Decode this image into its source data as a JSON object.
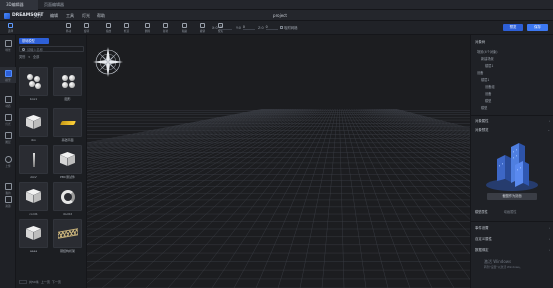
{
  "tabs": [
    "3D编辑器",
    "页面编辑器"
  ],
  "menu": {
    "logo": "DREAMSOFT",
    "items": [
      "文件",
      "编辑",
      "工具",
      "灯光",
      "帮助"
    ],
    "doc_title": "project"
  },
  "toolbar": {
    "tools": [
      "选择",
      "移动",
      "旋转",
      "缩放",
      "框选",
      "删除",
      "复制",
      "粘贴",
      "撤销",
      "聚焦"
    ],
    "coord_labels": [
      "X:0",
      "Y:0",
      "Z:0"
    ],
    "coord_values": [
      "0",
      "0",
      "0"
    ],
    "snap_label": "吸附网格",
    "preview_label": "预览",
    "save_label": "保存"
  },
  "rail": [
    "场景",
    "模型",
    "材质",
    "灯光",
    "图层",
    "上传",
    "我的",
    "资源"
  ],
  "library": {
    "category": "基础模型",
    "search_placeholder": "请输入名称",
    "filter_all": "类别",
    "filter_sel": "全部",
    "items": [
      {
        "name": "box1",
        "icon": "spheres"
      },
      {
        "name": "图形",
        "icon": "spheres-gray"
      },
      {
        "name": "ibo",
        "icon": "cube"
      },
      {
        "name": "基础平面",
        "icon": "plate"
      },
      {
        "name": "AGV",
        "icon": "pin"
      },
      {
        "name": "PBC测试件",
        "icon": "cube"
      },
      {
        "name": "cord1",
        "icon": "cube"
      },
      {
        "name": "doc02",
        "icon": "ring"
      },
      {
        "name": "aaaa",
        "icon": "cube"
      },
      {
        "name": "钢结构桁架",
        "icon": "truss"
      }
    ],
    "footer": [
      "共50条",
      "上一页",
      "下一页"
    ]
  },
  "properties": {
    "header": "对象树",
    "tree": [
      "场景(4个对象)",
      "新建场景",
      "楼层1",
      "设备",
      "楼层1",
      "设备组",
      "设备",
      "模型",
      "模型"
    ],
    "section_attrs": "对象属性",
    "section_preview": "对象预览",
    "apply_label": "截图作为封面",
    "tab_model": "模型属性",
    "tab_anim": "动画属性",
    "section_events": "事件设置",
    "section_custom": "自定义属性",
    "section_bind": "数据绑定",
    "activate_title": "激活 Windows",
    "activate_sub": "转到\"设置\"以激活 Windows。"
  },
  "colors": {
    "accent": "#2d5fd7",
    "bg": "#1b1c20",
    "grid": "#3a3d44"
  }
}
